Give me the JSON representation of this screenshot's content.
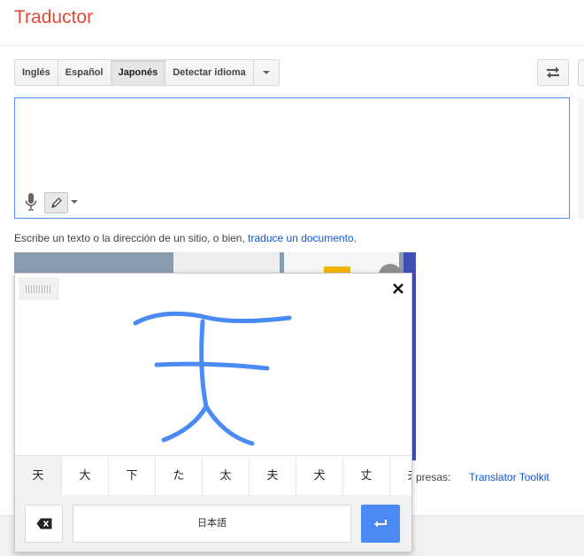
{
  "header": {
    "title": "Traductor"
  },
  "source_languages": {
    "tabs": [
      {
        "label": "Inglés",
        "active": false
      },
      {
        "label": "Español",
        "active": false
      },
      {
        "label": "Japonés",
        "active": true
      },
      {
        "label": "Detectar idioma",
        "active": false
      }
    ]
  },
  "source_input": {
    "value": ""
  },
  "helper": {
    "text": "Escribe un texto o la dirección de un sitio, o bien,",
    "link": "traduce un documento",
    "suffix": "."
  },
  "business": {
    "label": "presas:",
    "toolkit_link": "Translator Toolkit"
  },
  "handwriting": {
    "candidates": [
      "天",
      "大",
      "下",
      "た",
      "太",
      "夫",
      "犬",
      "丈",
      "夬"
    ],
    "space_label": "日本語",
    "stroke_color": "#4a8af4"
  },
  "colors": {
    "title": "#dd4b39",
    "link": "#1155cc",
    "accent": "#4d90fe",
    "enter": "#4a8af4"
  }
}
